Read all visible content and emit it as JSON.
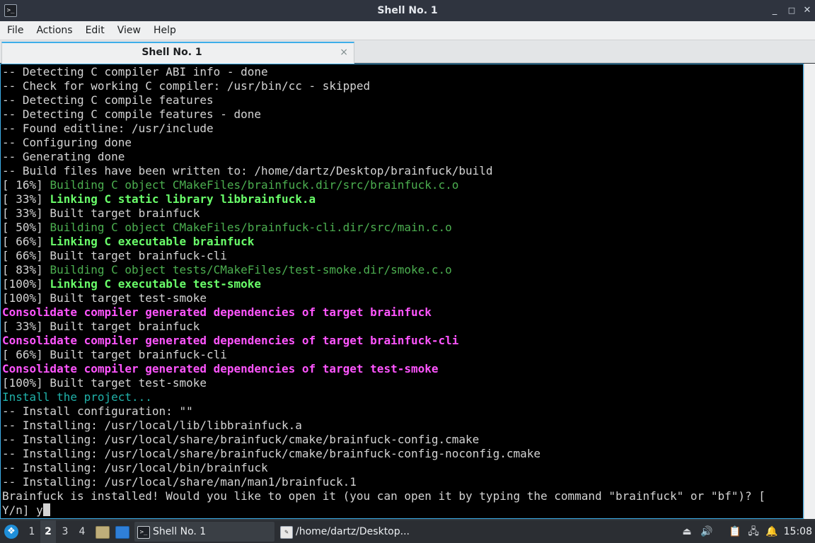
{
  "window": {
    "title": "Shell No. 1",
    "controls": {
      "minimize": "_",
      "maximize": "□",
      "close": "✕"
    }
  },
  "menu": [
    "File",
    "Actions",
    "Edit",
    "View",
    "Help"
  ],
  "tab": {
    "label": "Shell No. 1",
    "close": "×"
  },
  "terminal": {
    "lines": [
      {
        "segments": [
          {
            "text": "-- Detecting C compiler ABI info - done",
            "style": "plain"
          }
        ]
      },
      {
        "segments": [
          {
            "text": "-- Check for working C compiler: /usr/bin/cc - skipped",
            "style": "plain"
          }
        ]
      },
      {
        "segments": [
          {
            "text": "-- Detecting C compile features",
            "style": "plain"
          }
        ]
      },
      {
        "segments": [
          {
            "text": "-- Detecting C compile features - done",
            "style": "plain"
          }
        ]
      },
      {
        "segments": [
          {
            "text": "-- Found editline: /usr/include",
            "style": "plain"
          }
        ]
      },
      {
        "segments": [
          {
            "text": "-- Configuring done",
            "style": "plain"
          }
        ]
      },
      {
        "segments": [
          {
            "text": "-- Generating done",
            "style": "plain"
          }
        ]
      },
      {
        "segments": [
          {
            "text": "-- Build files have been written to: /home/dartz/Desktop/brainfuck/build",
            "style": "plain"
          }
        ]
      },
      {
        "segments": [
          {
            "text": "[ 16%] ",
            "style": "plain"
          },
          {
            "text": "Building C object CMakeFiles/brainfuck.dir/src/brainfuck.c.o",
            "style": "green"
          }
        ]
      },
      {
        "segments": [
          {
            "text": "[ 33%] ",
            "style": "plain"
          },
          {
            "text": "Linking C static library libbrainfuck.a",
            "style": "bgreen"
          }
        ]
      },
      {
        "segments": [
          {
            "text": "[ 33%] Built target brainfuck",
            "style": "plain"
          }
        ]
      },
      {
        "segments": [
          {
            "text": "[ 50%] ",
            "style": "plain"
          },
          {
            "text": "Building C object CMakeFiles/brainfuck-cli.dir/src/main.c.o",
            "style": "green"
          }
        ]
      },
      {
        "segments": [
          {
            "text": "[ 66%] ",
            "style": "plain"
          },
          {
            "text": "Linking C executable brainfuck",
            "style": "bgreen"
          }
        ]
      },
      {
        "segments": [
          {
            "text": "[ 66%] Built target brainfuck-cli",
            "style": "plain"
          }
        ]
      },
      {
        "segments": [
          {
            "text": "[ 83%] ",
            "style": "plain"
          },
          {
            "text": "Building C object tests/CMakeFiles/test-smoke.dir/smoke.c.o",
            "style": "green"
          }
        ]
      },
      {
        "segments": [
          {
            "text": "[100%] ",
            "style": "plain"
          },
          {
            "text": "Linking C executable test-smoke",
            "style": "bgreen"
          }
        ]
      },
      {
        "segments": [
          {
            "text": "[100%] Built target test-smoke",
            "style": "plain"
          }
        ]
      },
      {
        "segments": [
          {
            "text": "Consolidate compiler generated dependencies of target brainfuck",
            "style": "magenta"
          }
        ]
      },
      {
        "segments": [
          {
            "text": "[ 33%] Built target brainfuck",
            "style": "plain"
          }
        ]
      },
      {
        "segments": [
          {
            "text": "Consolidate compiler generated dependencies of target brainfuck-cli",
            "style": "magenta"
          }
        ]
      },
      {
        "segments": [
          {
            "text": "[ 66%] Built target brainfuck-cli",
            "style": "plain"
          }
        ]
      },
      {
        "segments": [
          {
            "text": "Consolidate compiler generated dependencies of target test-smoke",
            "style": "magenta"
          }
        ]
      },
      {
        "segments": [
          {
            "text": "[100%] Built target test-smoke",
            "style": "plain"
          }
        ]
      },
      {
        "segments": [
          {
            "text": "Install the project...",
            "style": "cyan"
          }
        ]
      },
      {
        "segments": [
          {
            "text": "-- Install configuration: \"\"",
            "style": "plain"
          }
        ]
      },
      {
        "segments": [
          {
            "text": "-- Installing: /usr/local/lib/libbrainfuck.a",
            "style": "plain"
          }
        ]
      },
      {
        "segments": [
          {
            "text": "-- Installing: /usr/local/share/brainfuck/cmake/brainfuck-config.cmake",
            "style": "plain"
          }
        ]
      },
      {
        "segments": [
          {
            "text": "-- Installing: /usr/local/share/brainfuck/cmake/brainfuck-config-noconfig.cmake",
            "style": "plain"
          }
        ]
      },
      {
        "segments": [
          {
            "text": "-- Installing: /usr/local/bin/brainfuck",
            "style": "plain"
          }
        ]
      },
      {
        "segments": [
          {
            "text": "-- Installing: /usr/local/share/man/man1/brainfuck.1",
            "style": "plain"
          }
        ]
      },
      {
        "segments": [
          {
            "text": "Brainfuck is installed! Would you like to open it (you can open it by typing the command \"brainfuck\" or \"bf\")? [",
            "style": "plain"
          }
        ]
      },
      {
        "segments": [
          {
            "text": "Y/n] y",
            "style": "plain"
          }
        ],
        "cursor": true
      }
    ]
  },
  "taskbar": {
    "start_icon": "start-menu-icon",
    "workspaces": [
      {
        "label": "1",
        "active": false
      },
      {
        "label": "2",
        "active": true
      },
      {
        "label": "3",
        "active": false
      },
      {
        "label": "4",
        "active": false
      }
    ],
    "launchers": [
      "file-manager-icon",
      "show-desktop-icon"
    ],
    "tasks": [
      {
        "label": "Shell No. 1",
        "icon": "terminal-icon",
        "active": true
      },
      {
        "label": "/home/dartz/Desktop...",
        "icon": "text-editor-icon",
        "active": false
      }
    ],
    "tray": [
      "eject-icon",
      "volume-icon",
      "clipboard-icon",
      "network-icon",
      "notifications-icon"
    ],
    "clock": "15:08"
  },
  "colors": {
    "accent": "#3daee9",
    "terminal_bg": "#000000",
    "terminal_fg": "#d4d4d4",
    "green": "#4caf50",
    "bright_green": "#6aff6a",
    "magenta": "#ff55ff",
    "cyan": "#20b2aa"
  }
}
